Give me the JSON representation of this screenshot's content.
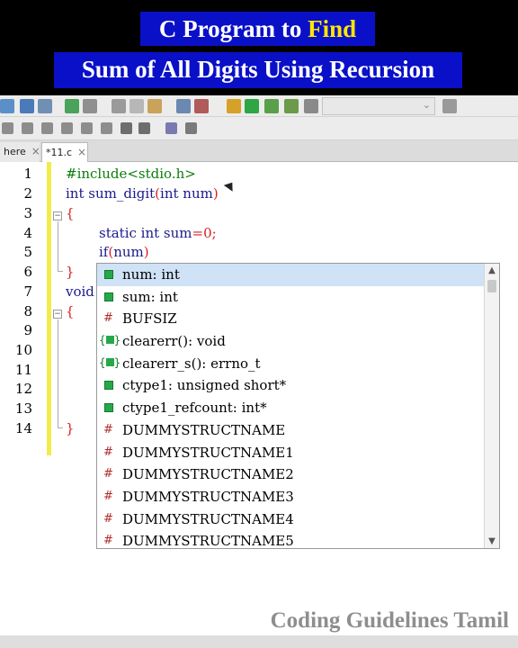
{
  "banner": {
    "line1_prefix": "C Program to ",
    "line1_highlight": "Find",
    "line2": "Sum of All Digits Using Recursion",
    "bg_color": "#0a10c8",
    "highlight_color": "#ffe600"
  },
  "tabs": [
    {
      "label": "here",
      "close": "×"
    },
    {
      "label": "*11.c",
      "close": "×"
    }
  ],
  "editor": {
    "line_numbers": [
      "1",
      "2",
      "3",
      "4",
      "5",
      "6",
      "7",
      "8",
      "9",
      "10",
      "11",
      "12",
      "13",
      "14"
    ],
    "lines": {
      "l1": "#include<stdio.h>",
      "l2a": "int sum_digit",
      "l2b": "(",
      "l2c": "int num",
      "l2d": ")",
      "l3": "{",
      "l4a": "static int sum",
      "l4b": "=",
      "l4c": "0",
      "l4d": ";",
      "l5a": "if",
      "l5b": "(",
      "l5c": "num",
      "l5d": ")",
      "l6": "}",
      "l7": "void",
      "l8": "{",
      "l14": "}"
    }
  },
  "autocomplete": {
    "items": [
      {
        "icon": "variable-icon",
        "label": "num: int"
      },
      {
        "icon": "variable-icon",
        "label": "sum: int"
      },
      {
        "icon": "macro-icon",
        "label": "BUFSIZ"
      },
      {
        "icon": "function-icon",
        "label": "clearerr(): void"
      },
      {
        "icon": "function-icon",
        "label": "clearerr_s(): errno_t"
      },
      {
        "icon": "variable-icon",
        "label": "ctype1: unsigned short*"
      },
      {
        "icon": "variable-icon",
        "label": "ctype1_refcount: int*"
      },
      {
        "icon": "macro-icon",
        "label": "DUMMYSTRUCTNAME"
      },
      {
        "icon": "macro-icon",
        "label": "DUMMYSTRUCTNAME1"
      },
      {
        "icon": "macro-icon",
        "label": "DUMMYSTRUCTNAME2"
      },
      {
        "icon": "macro-icon",
        "label": "DUMMYSTRUCTNAME3"
      },
      {
        "icon": "macro-icon",
        "label": "DUMMYSTRUCTNAME4"
      },
      {
        "icon": "macro-icon",
        "label": "DUMMYSTRUCTNAME5"
      }
    ],
    "macro_glyph": "#",
    "scroll_up": "▲",
    "scroll_down": "▼"
  },
  "watermark": "Coding Guidelines Tamil"
}
